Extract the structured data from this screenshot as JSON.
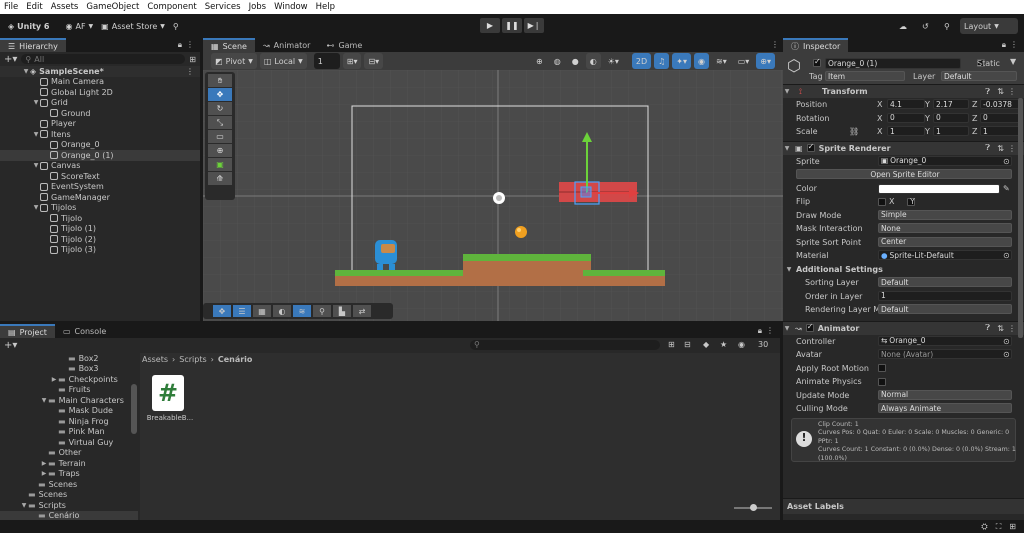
{
  "menu": [
    "File",
    "Edit",
    "Assets",
    "GameObject",
    "Component",
    "Services",
    "Jobs",
    "Window",
    "Help"
  ],
  "toolbar": {
    "unity": "Unity 6",
    "account": "AF",
    "asset_store": "Asset Store",
    "layout": "Layout"
  },
  "hierarchy": {
    "tab": "Hierarchy",
    "search_placeholder": "All",
    "scene": "SampleScene*",
    "items": [
      {
        "label": "Main Camera",
        "depth": 1
      },
      {
        "label": "Global Light 2D",
        "depth": 1
      },
      {
        "label": "Grid",
        "depth": 1,
        "expanded": true
      },
      {
        "label": "Ground",
        "depth": 2
      },
      {
        "label": "Player",
        "depth": 1
      },
      {
        "label": "Itens",
        "depth": 1,
        "expanded": true
      },
      {
        "label": "Orange_0",
        "depth": 2
      },
      {
        "label": "Orange_0 (1)",
        "depth": 2,
        "selected": true
      },
      {
        "label": "Canvas",
        "depth": 1,
        "expanded": true
      },
      {
        "label": "ScoreText",
        "depth": 2
      },
      {
        "label": "EventSystem",
        "depth": 1
      },
      {
        "label": "GameManager",
        "depth": 1
      },
      {
        "label": "Tijolos",
        "depth": 1,
        "expanded": true
      },
      {
        "label": "Tijolo",
        "depth": 2
      },
      {
        "label": "Tijolo (1)",
        "depth": 2
      },
      {
        "label": "Tijolo (2)",
        "depth": 2
      },
      {
        "label": "Tijolo (3)",
        "depth": 2
      }
    ]
  },
  "scene": {
    "tabs": [
      "Scene",
      "Animator",
      "Game"
    ],
    "pivot": "Pivot",
    "local": "Local",
    "grid_step": "1",
    "twod": "2D"
  },
  "project": {
    "tabs": [
      "Project",
      "Console"
    ],
    "breadcrumb": [
      "Assets",
      "Scripts",
      "Cenário"
    ],
    "count": "30",
    "tree": [
      {
        "label": "Box2",
        "depth": 3
      },
      {
        "label": "Box3",
        "depth": 3
      },
      {
        "label": "Checkpoints",
        "depth": 2,
        "arrow": "▶"
      },
      {
        "label": "Fruits",
        "depth": 2
      },
      {
        "label": "Main Characters",
        "depth": 1,
        "arrow": "▼"
      },
      {
        "label": "Mask Dude",
        "depth": 2
      },
      {
        "label": "Ninja Frog",
        "depth": 2
      },
      {
        "label": "Pink Man",
        "depth": 2
      },
      {
        "label": "Virtual Guy",
        "depth": 2
      },
      {
        "label": "Other",
        "depth": 1
      },
      {
        "label": "Terrain",
        "depth": 1,
        "arrow": "▶"
      },
      {
        "label": "Traps",
        "depth": 1,
        "arrow": "▶"
      },
      {
        "label": "Scenes",
        "depth": 0
      },
      {
        "label": "Scenes",
        "depth": -1
      },
      {
        "label": "Scripts",
        "depth": -1,
        "arrow": "▼"
      },
      {
        "label": "Cenário",
        "depth": 0,
        "selected": true
      }
    ],
    "file_label": "BreakableB..."
  },
  "inspector": {
    "tab": "Inspector",
    "object_name": "Orange_0 (1)",
    "static": "Static",
    "tag_label": "Tag",
    "tag": "Item",
    "layer_label": "Layer",
    "layer": "Default",
    "transform": {
      "title": "Transform",
      "position": {
        "label": "Position",
        "x": "4.1",
        "y": "2.17",
        "z": "-0.0378"
      },
      "rotation": {
        "label": "Rotation",
        "x": "0",
        "y": "0",
        "z": "0"
      },
      "scale": {
        "label": "Scale",
        "x": "1",
        "y": "1",
        "z": "1"
      }
    },
    "sprite_renderer": {
      "title": "Sprite Renderer",
      "sprite_label": "Sprite",
      "sprite": "Orange_0",
      "edit_button": "Open Sprite Editor",
      "color_label": "Color",
      "flip_label": "Flip",
      "flip_x": "X",
      "flip_y": "Y",
      "draw_mode_label": "Draw Mode",
      "draw_mode": "Simple",
      "mask_label": "Mask Interaction",
      "mask": "None",
      "sort_point_label": "Sprite Sort Point",
      "sort_point": "Center",
      "material_label": "Material",
      "material": "Sprite-Lit-Default",
      "additional": "Additional Settings",
      "sorting_layer_label": "Sorting Layer",
      "sorting_layer": "Default",
      "order_label": "Order in Layer",
      "order": "1",
      "rendering_layer_label": "Rendering Layer M",
      "rendering_layer": "Default"
    },
    "animator": {
      "title": "Animator",
      "controller_label": "Controller",
      "controller": "Orange_0",
      "avatar_label": "Avatar",
      "avatar": "None (Avatar)",
      "root_motion_label": "Apply Root Motion",
      "physics_label": "Animate Physics",
      "update_label": "Update Mode",
      "update": "Normal",
      "culling_label": "Culling Mode",
      "culling": "Always Animate",
      "info": "Clip Count: 1\nCurves Pos: 0 Quat: 0 Euler: 0 Scale: 0 Muscles: 0 Generic: 0 PPtr: 1\nCurves Count: 1 Constant: 0 (0.0%) Dense: 0 (0.0%) Stream: 1 (100.0%)"
    },
    "asset_labels": "Asset Labels"
  },
  "colors": {
    "accent": "#3a79bb",
    "scene_bg": "#4a4a4a",
    "grass": "#5fb43c",
    "dirt": "#b26f46",
    "brick": "#d24848"
  }
}
